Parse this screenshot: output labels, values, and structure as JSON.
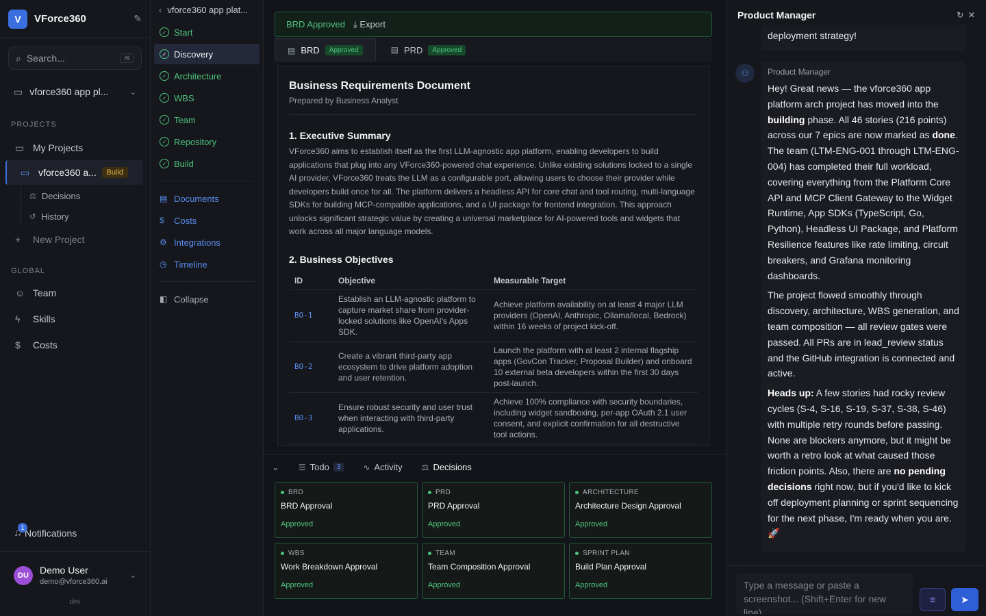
{
  "sidebar": {
    "brand": "VForce360",
    "logo_letter": "V",
    "search_placeholder": "Search...",
    "search_shortcut": "/K",
    "project_select": "vforce360 app pl...",
    "projects_label": "PROJECTS",
    "my_projects": "My Projects",
    "current_project": "vforce360 a...",
    "build_badge": "Build",
    "sub_decisions": "Decisions",
    "sub_history": "History",
    "new_project": "New Project",
    "global_label": "GLOBAL",
    "team": "Team",
    "skills": "Skills",
    "costs": "Costs",
    "notifications": "Notifications",
    "notif_count": "1",
    "user_initials": "DU",
    "user_name": "Demo User",
    "user_email": "demo@vforce360.ai",
    "env": "dev"
  },
  "phases": {
    "back_title": "vforce360 app plat...",
    "items": [
      "Start",
      "Discovery",
      "Architecture",
      "WBS",
      "Team",
      "Repository",
      "Build"
    ],
    "sections": [
      "Documents",
      "Costs",
      "Integrations",
      "Timeline"
    ],
    "collapse": "Collapse"
  },
  "main": {
    "approved": "BRD Approved",
    "export": "Export",
    "tabs": [
      {
        "label": "BRD",
        "status": "Approved"
      },
      {
        "label": "PRD",
        "status": "Approved"
      }
    ],
    "doc": {
      "title": "Business Requirements Document",
      "subtitle": "Prepared by Business Analyst",
      "s1": "1. Executive Summary",
      "s1_body": "VForce360 aims to establish itself as the first LLM-agnostic app platform, enabling developers to build applications that plug into any VForce360-powered chat experience. Unlike existing solutions locked to a single AI provider, VForce360 treats the LLM as a configurable port, allowing users to choose their provider while developers build once for all. The platform delivers a headless API for core chat and tool routing, multi-language SDKs for building MCP-compatible applications, and a UI package for frontend integration. This approach unlocks significant strategic value by creating a universal marketplace for AI-powered tools and widgets that work across all major language models.",
      "s2": "2. Business Objectives",
      "cols": [
        "ID",
        "Objective",
        "Measurable Target"
      ],
      "rows": [
        {
          "id": "BO-1",
          "objective": "Establish an LLM-agnostic platform to capture market share from provider-locked solutions like OpenAI's Apps SDK.",
          "target": "Achieve platform availability on at least 4 major LLM providers (OpenAI, Anthropic, Ollama/local, Bedrock) within 16 weeks of project kick-off."
        },
        {
          "id": "BO-2",
          "objective": "Create a vibrant third-party app ecosystem to drive platform adoption and user retention.",
          "target": "Launch the platform with at least 2 internal flagship apps (GovCon Tracker, Proposal Builder) and onboard 10 external beta developers within the first 30 days post-launch."
        },
        {
          "id": "BO-3",
          "objective": "Ensure robust security and user trust when interacting with third-party applications.",
          "target": "Achieve 100% compliance with security boundaries, including widget sandboxing, per-app OAuth 2.1 user consent, and explicit confirmation for all destructive tool actions."
        }
      ]
    },
    "bottom_tabs": {
      "todo": "Todo",
      "todo_count": "3",
      "activity": "Activity",
      "decisions": "Decisions"
    },
    "cards": [
      {
        "cat": "BRD",
        "title": "BRD Approval",
        "status": "Approved"
      },
      {
        "cat": "PRD",
        "title": "PRD Approval",
        "status": "Approved"
      },
      {
        "cat": "ARCHITECTURE",
        "title": "Architecture Design Approval",
        "status": "Approved"
      },
      {
        "cat": "WBS",
        "title": "Work Breakdown Approval",
        "status": "Approved"
      },
      {
        "cat": "TEAM",
        "title": "Team Composition Approval",
        "status": "Approved"
      },
      {
        "cat": "SPRINT PLAN",
        "title": "Build Plan Approval",
        "status": "Approved"
      }
    ]
  },
  "chat": {
    "title": "Product Manager",
    "prev_msg": "deployment strategy!",
    "sender": "Product Manager",
    "p1a": "Hey! Great news — the vforce360 app platform arch project has moved into the ",
    "p1b": "building",
    "p1c": " phase. All 46 stories (216 points) across our 7 epics are now marked as ",
    "p1d": "done",
    "p1e": ". The team (LTM-ENG-001 through LTM-ENG-004) has completed their full workload, covering everything from the Platform Core API and MCP Client Gateway to the Widget Runtime, App SDKs (TypeScript, Go, Python), Headless UI Package, and Platform Resilience features like rate limiting, circuit breakers, and Grafana monitoring dashboards.",
    "p2": "The project flowed smoothly through discovery, architecture, WBS generation, and team composition — all review gates were passed. All PRs are in lead_review status and the GitHub integration is connected and active.",
    "p3a": "Heads up:",
    "p3b": " A few stories had rocky review cycles (S-4, S-16, S-19, S-37, S-38, S-46) with multiple retry rounds before passing. None are blockers anymore, but it might be worth a retro look at what caused those friction points. Also, there are ",
    "p3c": "no pending decisions",
    "p3d": " right now, but if you'd like to kick off deployment planning or sprint sequencing for the next phase, I'm ready when you are. 🚀",
    "input_placeholder": "Type a message or paste a screenshot... (Shift+Enter for new line)"
  }
}
